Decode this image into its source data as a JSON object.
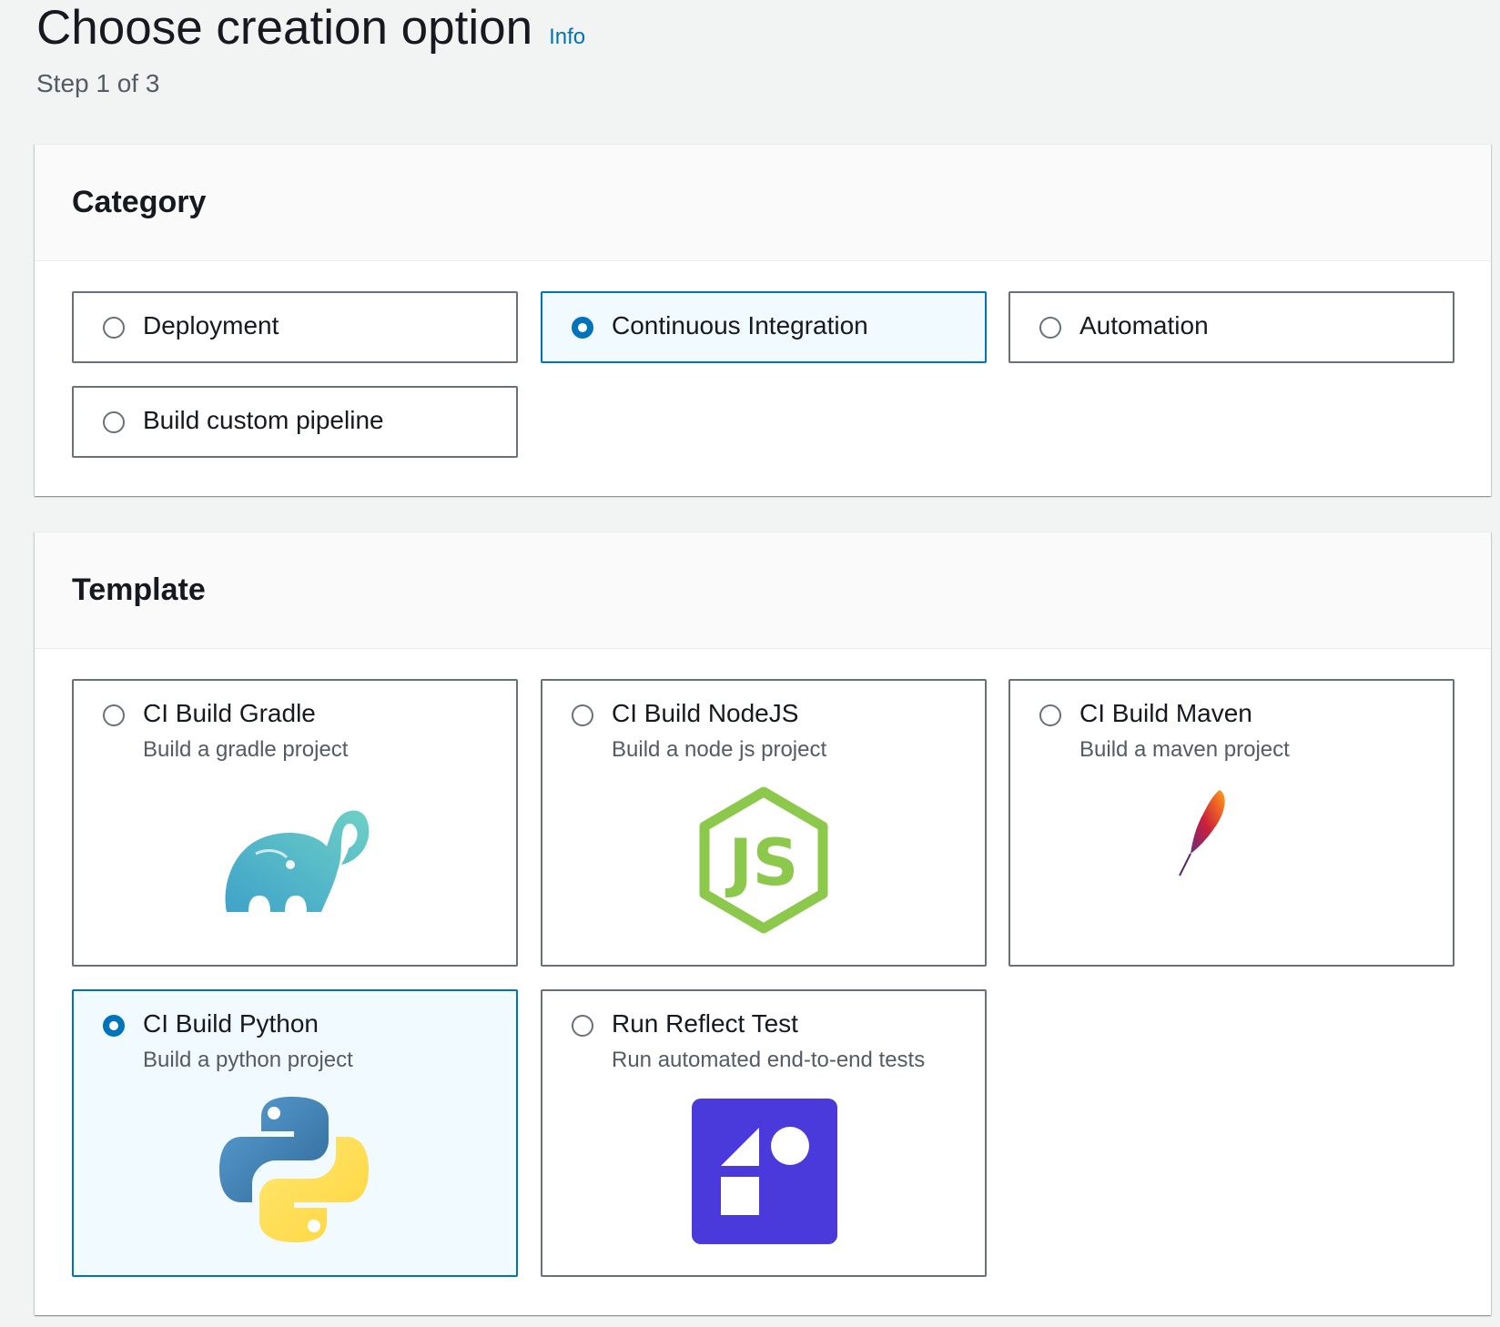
{
  "header": {
    "title": "Choose creation option",
    "info_label": "Info",
    "step": "Step 1 of 3"
  },
  "category": {
    "title": "Category",
    "options": [
      {
        "label": "Deployment",
        "selected": false
      },
      {
        "label": "Continuous Integration",
        "selected": true
      },
      {
        "label": "Automation",
        "selected": false
      },
      {
        "label": "Build custom pipeline",
        "selected": false
      }
    ]
  },
  "template": {
    "title": "Template",
    "options": [
      {
        "label": "CI Build Gradle",
        "description": "Build a gradle project",
        "icon": "gradle-elephant-icon",
        "selected": false
      },
      {
        "label": "CI Build NodeJS",
        "description": "Build a node js project",
        "icon": "nodejs-icon",
        "selected": false
      },
      {
        "label": "CI Build Maven",
        "description": "Build a maven project",
        "icon": "apache-feather-icon",
        "selected": false
      },
      {
        "label": "CI Build Python",
        "description": "Build a python project",
        "icon": "python-icon",
        "selected": true
      },
      {
        "label": "Run Reflect Test",
        "description": "Run automated end-to-end tests",
        "icon": "reflect-icon",
        "selected": false
      }
    ]
  },
  "colors": {
    "accent": "#0073bb",
    "selected_bg": "#f1faff",
    "gradle": "#4fb3c9",
    "nodejs": "#8cc84b",
    "python_blue": "#3776ab",
    "python_yellow": "#ffd43b",
    "reflect": "#4a3adb"
  }
}
